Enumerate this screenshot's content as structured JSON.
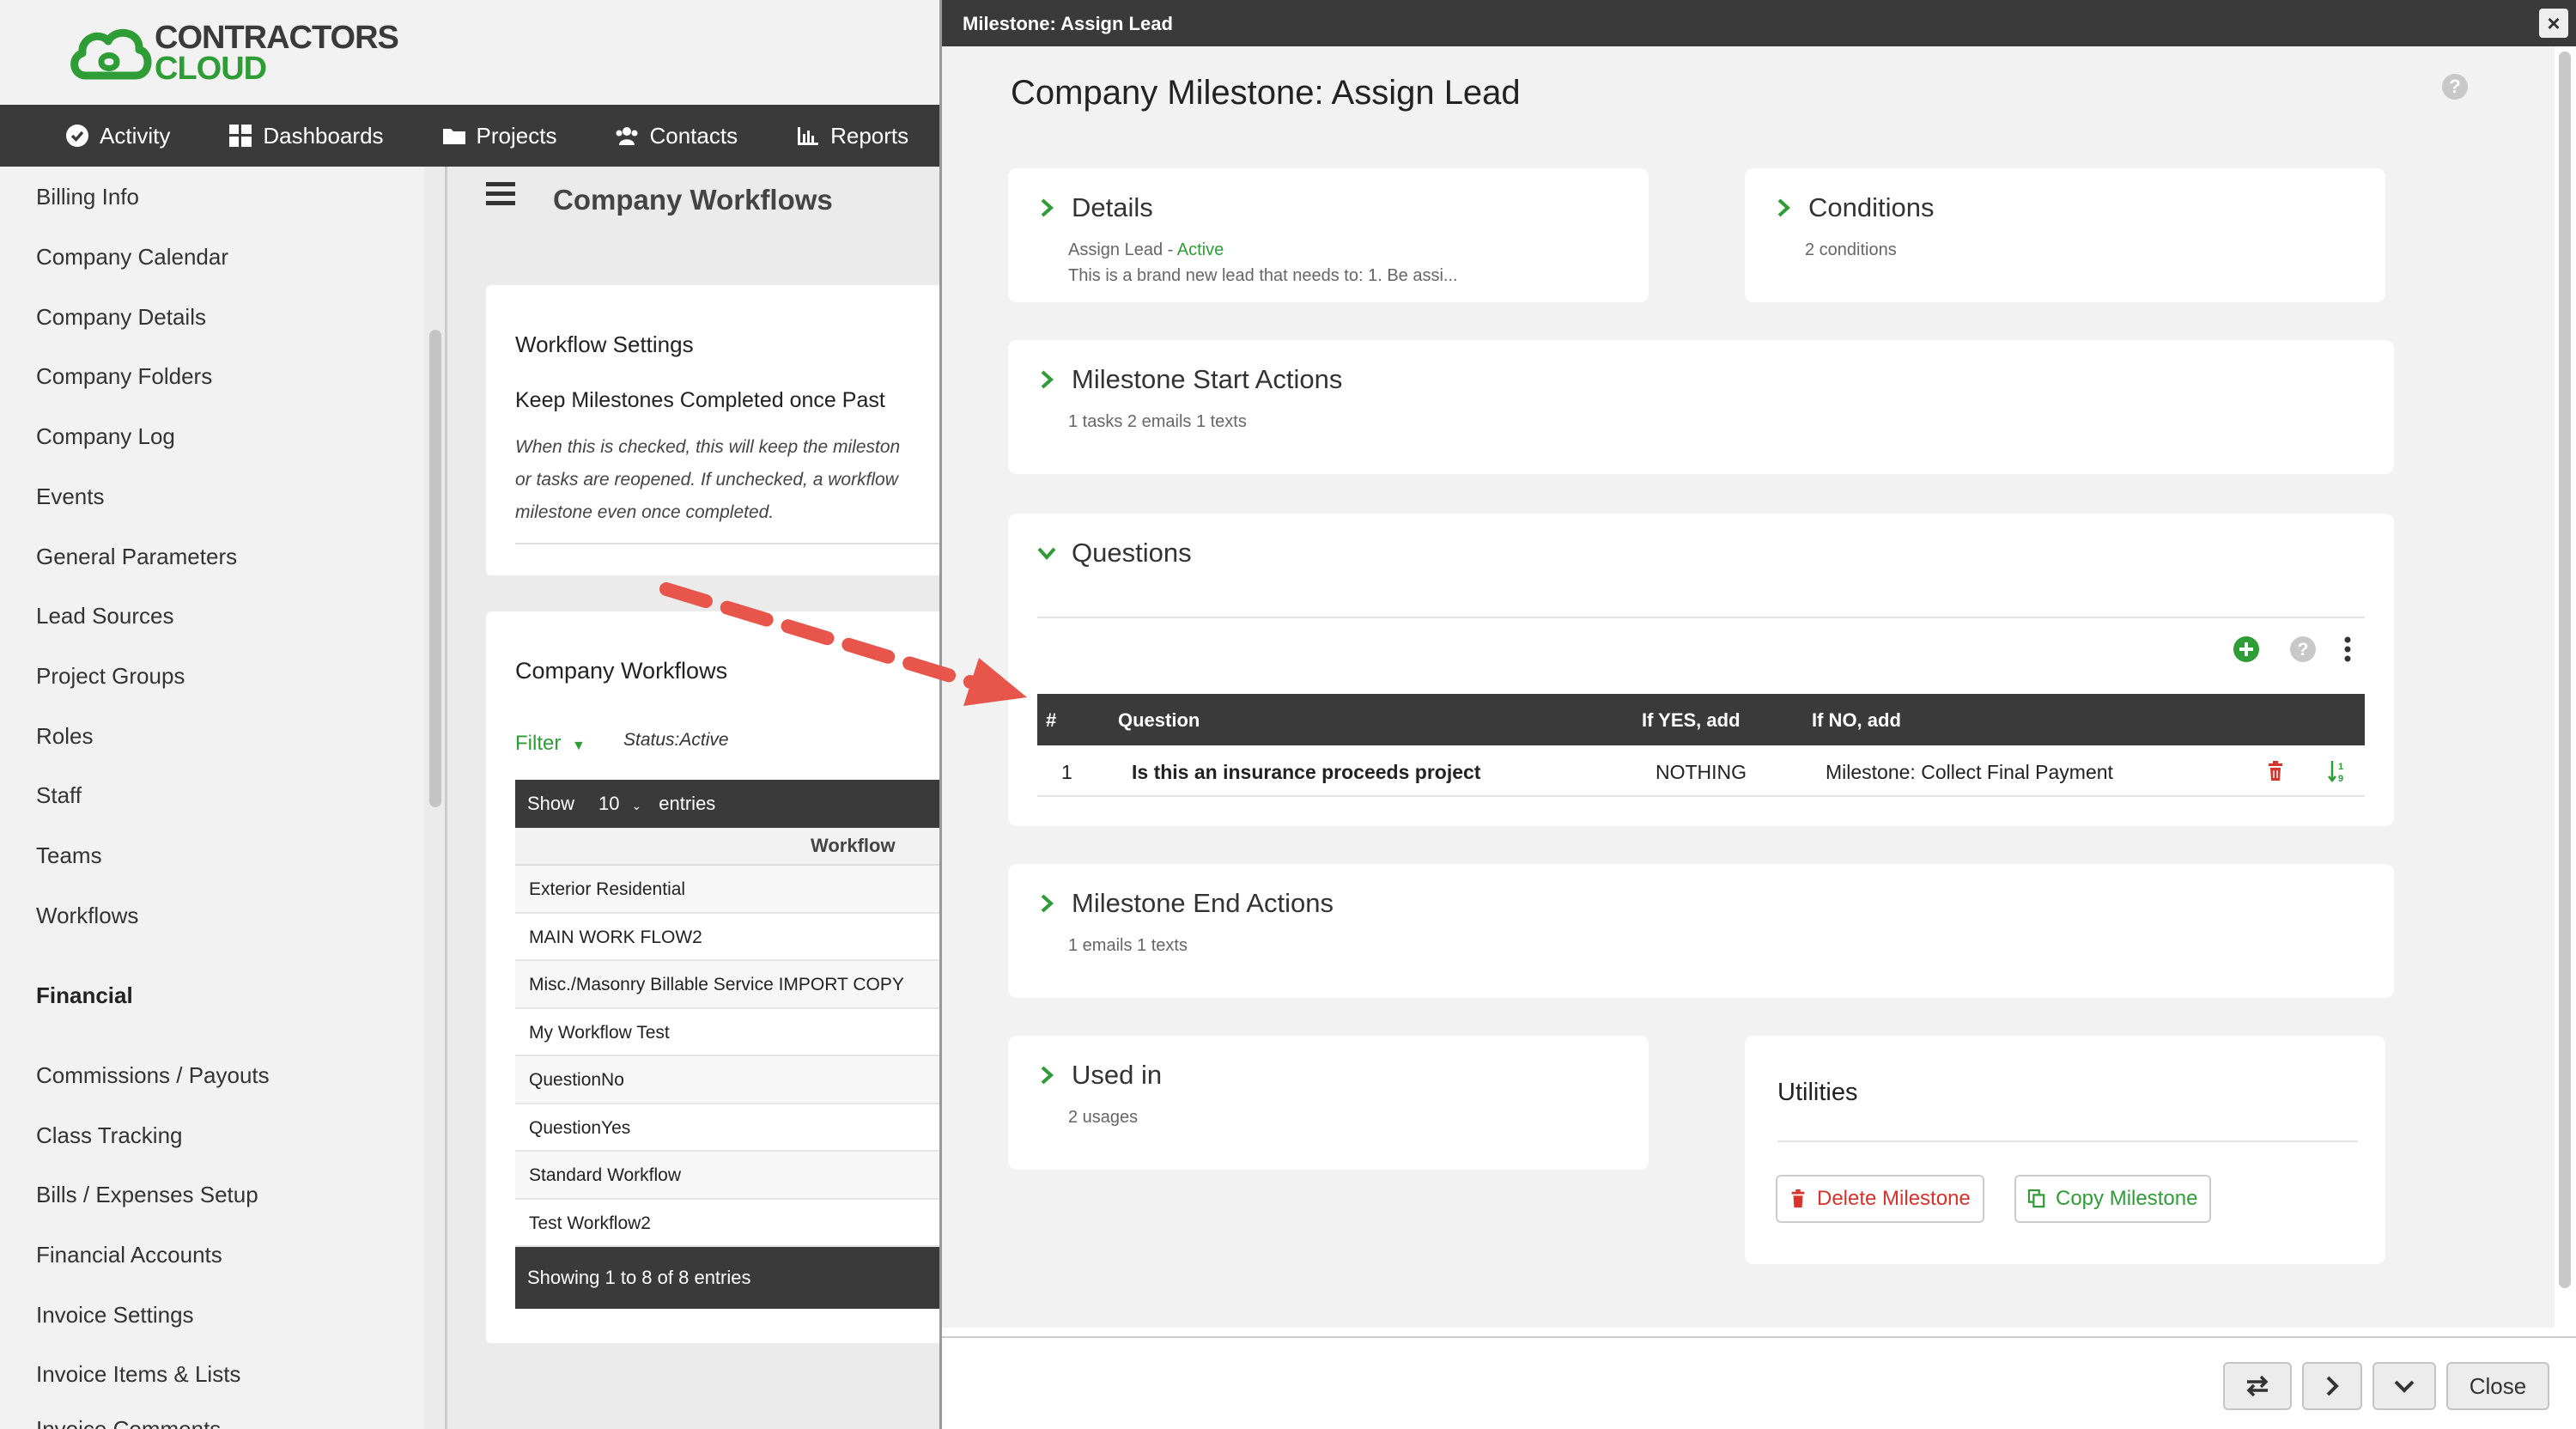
{
  "logo": {
    "line1": "CONTRACTORS",
    "line2": "CLOUD"
  },
  "topnav": {
    "items": [
      {
        "label": "Activity",
        "icon": "check-circle-icon"
      },
      {
        "label": "Dashboards",
        "icon": "grid-icon"
      },
      {
        "label": "Projects",
        "icon": "folder-icon"
      },
      {
        "label": "Contacts",
        "icon": "users-icon"
      },
      {
        "label": "Reports",
        "icon": "bar-chart-icon"
      }
    ]
  },
  "sidebar": {
    "items": [
      "Billing Info",
      "Company Calendar",
      "Company Details",
      "Company Folders",
      "Company Log",
      "Events",
      "General Parameters",
      "Lead Sources",
      "Project Groups",
      "Roles",
      "Staff",
      "Teams",
      "Workflows",
      "Financial",
      "Commissions / Payouts",
      "Class Tracking",
      "Bills / Expenses Setup",
      "Financial Accounts",
      "Invoice Settings",
      "Invoice Items & Lists",
      "Invoice Comments"
    ]
  },
  "main": {
    "title": "Company Workflows",
    "settings": {
      "title": "Workflow Settings",
      "keep_label": "Keep Milestones Completed once Past",
      "desc_lines": [
        "When this is checked, this will keep the mileston",
        "or tasks are reopened. If unchecked, a workflow",
        "milestone even once completed."
      ]
    },
    "workflows": {
      "title": "Company Workflows",
      "filter_label": "Filter",
      "status": "Status:Active",
      "show_prefix": "Show",
      "show_value": "10",
      "show_suffix": "entries",
      "column": "Workflow",
      "rows": [
        "Exterior Residential",
        "MAIN WORK FLOW2",
        "Misc./Masonry Billable Service IMPORT COPY",
        "My Workflow Test",
        "QuestionNo",
        "QuestionYes",
        "Standard Workflow",
        "Test Workflow2"
      ],
      "footer": "Showing 1 to 8 of 8 entries"
    }
  },
  "modal": {
    "titlebar": "Milestone: Assign Lead",
    "heading": "Company Milestone: Assign Lead",
    "help": "?",
    "details": {
      "title": "Details",
      "sub_name": "Assign Lead - ",
      "sub_status": "Active",
      "sub_desc": "This is a brand new lead that needs to: 1. Be assi..."
    },
    "conditions": {
      "title": "Conditions",
      "sub": "2 conditions"
    },
    "start_actions": {
      "title": "Milestone Start Actions",
      "sub": "1 tasks 2 emails 1 texts"
    },
    "questions": {
      "title": "Questions",
      "headers": {
        "num": "#",
        "question": "Question",
        "yes": "If YES, add",
        "no": "If NO, add"
      },
      "rows": [
        {
          "num": "1",
          "question": "Is this an insurance proceeds project",
          "yes": "NOTHING",
          "no": "Milestone: Collect Final Payment"
        }
      ]
    },
    "end_actions": {
      "title": "Milestone End Actions",
      "sub": "1 emails 1 texts"
    },
    "used_in": {
      "title": "Used in",
      "sub": "2 usages"
    },
    "utilities": {
      "title": "Utilities",
      "delete_label": "Delete Milestone",
      "copy_label": "Copy Milestone"
    },
    "footer": {
      "close_label": "Close"
    }
  },
  "colors": {
    "accent_green": "#2e9d35",
    "danger_red": "#d9312b",
    "nav_dark": "#3a3a3a",
    "arrow": "#e8554a"
  }
}
